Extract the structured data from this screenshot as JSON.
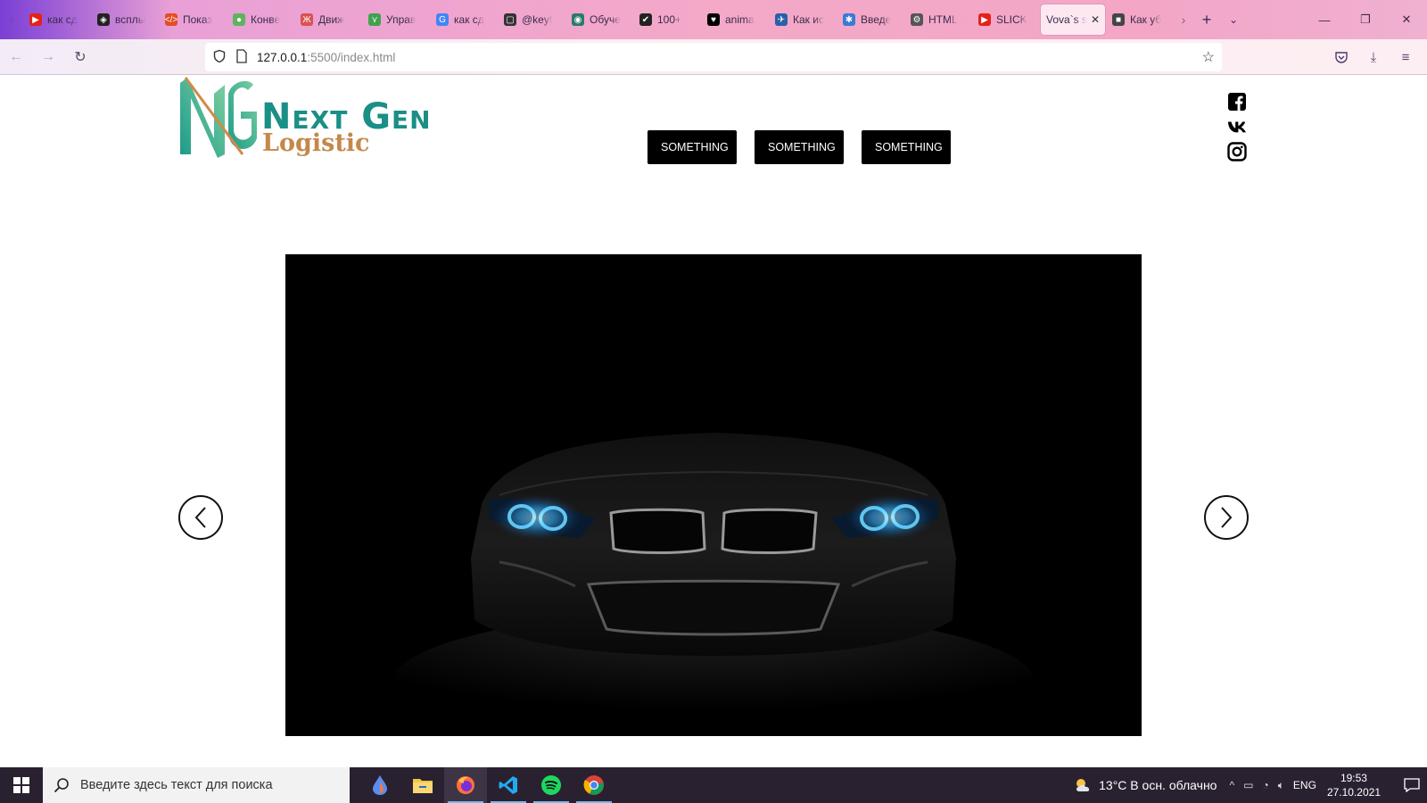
{
  "browser": {
    "tabs": [
      {
        "label": "как сд",
        "fav_color": "#e62117",
        "fav_glyph": "▶"
      },
      {
        "label": "всплы",
        "fav_color": "#222222",
        "fav_glyph": "◈"
      },
      {
        "label": "Показ",
        "fav_color": "#e44d26",
        "fav_glyph": "</>"
      },
      {
        "label": "Конве",
        "fav_color": "#5fb35f",
        "fav_glyph": "●"
      },
      {
        "label": "Движ",
        "fav_color": "#d9534f",
        "fav_glyph": "Ж"
      },
      {
        "label": "Управ",
        "fav_color": "#3fa34d",
        "fav_glyph": "⋎"
      },
      {
        "label": "как сд",
        "fav_color": "#4285f4",
        "fav_glyph": "G"
      },
      {
        "label": "@keyf",
        "fav_color": "#333333",
        "fav_glyph": "▢"
      },
      {
        "label": "Обуче",
        "fav_color": "#2a7a6a",
        "fav_glyph": "◉"
      },
      {
        "label": "100+ ",
        "fav_color": "#222222",
        "fav_glyph": "✔"
      },
      {
        "label": "anima",
        "fav_color": "#000000",
        "fav_glyph": "♥"
      },
      {
        "label": "Как ис",
        "fav_color": "#2a5fa8",
        "fav_glyph": "✈"
      },
      {
        "label": "Введе",
        "fav_color": "#3a7bd5",
        "fav_glyph": "✱"
      },
      {
        "label": "HTML",
        "fav_color": "#555555",
        "fav_glyph": "⚙"
      },
      {
        "label": "SLICK",
        "fav_color": "#e62117",
        "fav_glyph": "▶"
      },
      {
        "label": "Vova`s s",
        "fav_color": "#ffffff",
        "fav_glyph": "",
        "active": true
      },
      {
        "label": "Как уб",
        "fav_color": "#444444",
        "fav_glyph": "■"
      }
    ],
    "url_host": "127.0.0.1",
    "url_path": ":5500/index.html"
  },
  "site": {
    "logo_title": "Next Gen",
    "logo_subtitle": "Logistic",
    "menu": [
      "SOMETHING",
      "SOMETHING",
      "SOMETHING"
    ],
    "social_icons": [
      "facebook-icon",
      "vk-icon",
      "instagram-icon"
    ]
  },
  "taskbar": {
    "search_placeholder": "Введите здесь текст для поиска",
    "weather": "13°C  В осн. облачно",
    "language": "ENG",
    "time": "19:53",
    "date": "27.10.2021"
  }
}
